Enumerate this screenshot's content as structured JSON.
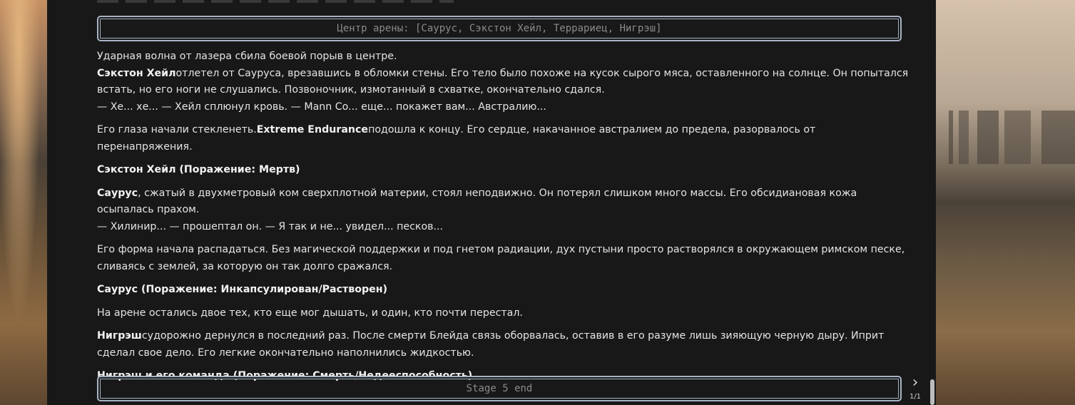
{
  "header": {
    "arena_center": "Центр арены: [Саурус, Сэкстон Хейл, Террариец, Нигрэш]"
  },
  "story": {
    "p1_line1": "Ударная волна от лазера сбила боевой порыв в центре.",
    "p1_bold": "Сэкстон Хейл",
    "p1_line2": "отлетел от Сауруса, врезавшись в обломки стены. Его тело было похоже на кусок сырого мяса, оставленного на солнце. Он попытался встать, но его ноги не слушались. Позвоночник, измотанный в схватке, окончательно сдался.",
    "p1_line3": "— Хе... хе... — Хейл сплюнул кровь. — Mann Co... еще... покажет вам... Австралию...",
    "p2_start": "Его глаза начали стекленеть.",
    "p2_bold": "Extreme Endurance",
    "p2_end": "подошла к концу. Его сердце, накачанное австралием до предела, разорвалось от перенапряжения.",
    "p3_bold": "Сэкстон Хейл (Поражение: Мертв)",
    "p4_bold": "Саурус",
    "p4_text": ", сжатый в двухметровый ком сверхплотной материи, стоял неподвижно. Он потерял слишком много массы. Его обсидиановая кожа осыпалась прахом.",
    "p4_line2": "— Хилинир... — прошептал он. — Я так и не... увидел... песков...",
    "p5_text": "Его форма начала распадаться. Без магической поддержки и под гнетом радиации, дух пустыни просто растворялся в окружающем римском песке, сливаясь с землей, за которую он так долго сражался.",
    "p6_bold": "Саурус (Поражение: Инкапсулирован/Растворен)",
    "p7_text": "На арене остались двое тех, кто еще мог дышать, и один, кто почти перестал.",
    "p8_bold": "Нигрэш",
    "p8_text": "судорожно дернулся в последний раз. После смерти Блейда связь оборвалась, оставив в его разуме лишь зияющую черную дыру. Иприт сделал свое дело. Его легкие окончательно наполнились жидкостью.",
    "p9_bold": "Нигрэш и его команда (Поражение: Смерть/Недееспособность)"
  },
  "footer": {
    "stage_label": "Stage 5 end"
  },
  "nav": {
    "next_glyph": "›",
    "page_counter": "1/1"
  }
}
